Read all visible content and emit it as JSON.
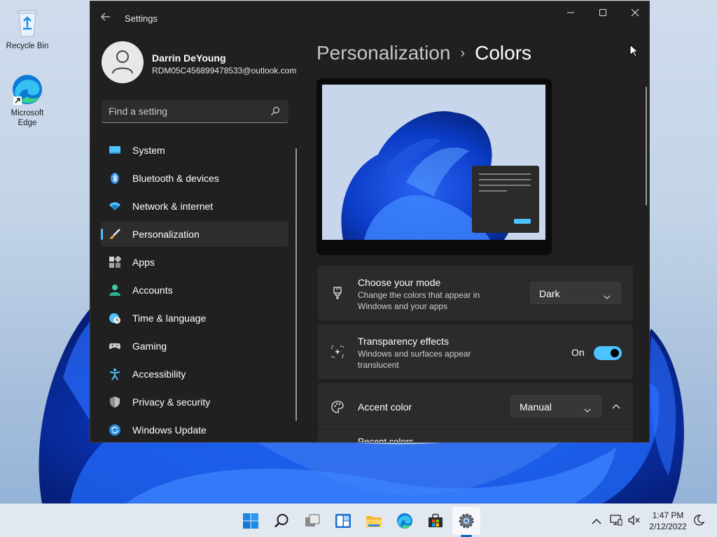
{
  "desktop": {
    "icons": [
      {
        "label": "Recycle Bin"
      },
      {
        "label": "Microsoft Edge"
      }
    ]
  },
  "window": {
    "title": "Settings",
    "profile": {
      "name": "Darrin DeYoung",
      "email": "RDM05C456899478533@outlook.com"
    },
    "search": {
      "placeholder": "Find a setting"
    },
    "nav": [
      {
        "label": "System",
        "icon": "system-icon"
      },
      {
        "label": "Bluetooth & devices",
        "icon": "bluetooth-icon"
      },
      {
        "label": "Network & internet",
        "icon": "wifi-icon"
      },
      {
        "label": "Personalization",
        "icon": "brush-icon",
        "active": true
      },
      {
        "label": "Apps",
        "icon": "apps-icon"
      },
      {
        "label": "Accounts",
        "icon": "accounts-icon"
      },
      {
        "label": "Time & language",
        "icon": "clock-globe-icon"
      },
      {
        "label": "Gaming",
        "icon": "gamepad-icon"
      },
      {
        "label": "Accessibility",
        "icon": "accessibility-icon"
      },
      {
        "label": "Privacy & security",
        "icon": "shield-icon"
      },
      {
        "label": "Windows Update",
        "icon": "update-icon"
      }
    ],
    "breadcrumb": {
      "parent": "Personalization",
      "separator": "›",
      "current": "Colors"
    },
    "cards": {
      "mode": {
        "title": "Choose your mode",
        "description": "Change the colors that appear in Windows and your apps",
        "value": "Dark"
      },
      "transparency": {
        "title": "Transparency effects",
        "description": "Windows and surfaces appear translucent",
        "state_label": "On",
        "enabled": true
      },
      "accent": {
        "title": "Accent color",
        "value": "Manual",
        "sub_peek": "Recent colors"
      }
    },
    "colors": {
      "accent": "#4cc2ff",
      "background": "#202020",
      "card": "#2b2b2b"
    }
  },
  "taskbar": {
    "apps": [
      "start-icon",
      "search-icon",
      "task-view-icon",
      "widgets-icon",
      "file-explorer-icon",
      "edge-icon",
      "store-icon",
      "settings-icon"
    ],
    "clock": {
      "time": "1:47 PM",
      "date": "2/12/2022"
    }
  }
}
